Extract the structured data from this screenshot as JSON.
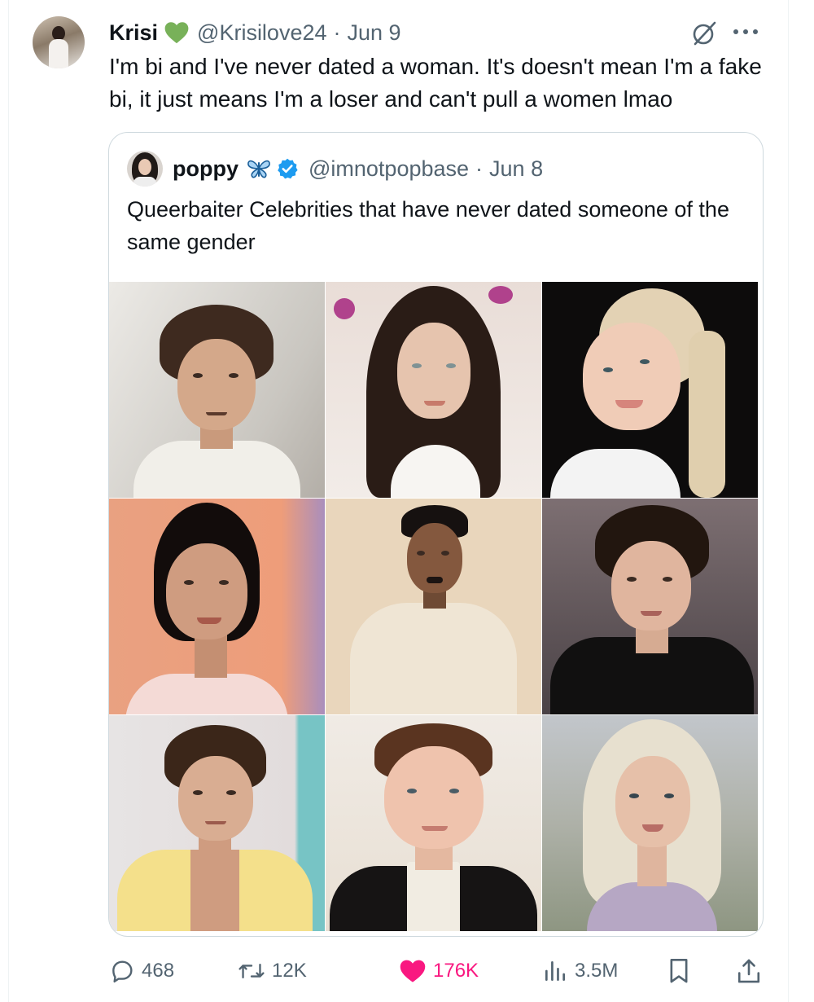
{
  "tweet": {
    "author_name": "Krisi",
    "author_handle": "@Krisilove24",
    "separator": "·",
    "date": "Jun 9",
    "text": "I'm bi and I've never dated a woman. It's doesn't mean I'm a fake bi, it just means I'm a loser and can't pull a women lmao",
    "name_emoji_icon": "green-heart-icon"
  },
  "quote": {
    "author_name": "poppy",
    "author_handle": "@imnotpopbase",
    "separator": "·",
    "date": "Jun 8",
    "text": "Queerbaiter Celebrities that have never dated someone of the same gender",
    "name_emoji_icon": "butterfly-icon",
    "badge_icon": "verified-badge-icon",
    "image_grid": {
      "rows": 3,
      "columns": 3,
      "photos": [
        {
          "id": "photo-1"
        },
        {
          "id": "photo-2"
        },
        {
          "id": "photo-3"
        },
        {
          "id": "photo-4"
        },
        {
          "id": "photo-5"
        },
        {
          "id": "photo-6"
        },
        {
          "id": "photo-7"
        },
        {
          "id": "photo-8"
        },
        {
          "id": "photo-9"
        }
      ]
    }
  },
  "actions": {
    "replies": "468",
    "reposts": "12K",
    "likes": "176K",
    "views": "3.5M"
  },
  "colors": {
    "text_primary": "#0f1419",
    "text_secondary": "#536471",
    "like_active": "#f91880",
    "verified_blue": "#1d9bf0",
    "heart_green": "#78b159",
    "border": "#cfd9de"
  }
}
